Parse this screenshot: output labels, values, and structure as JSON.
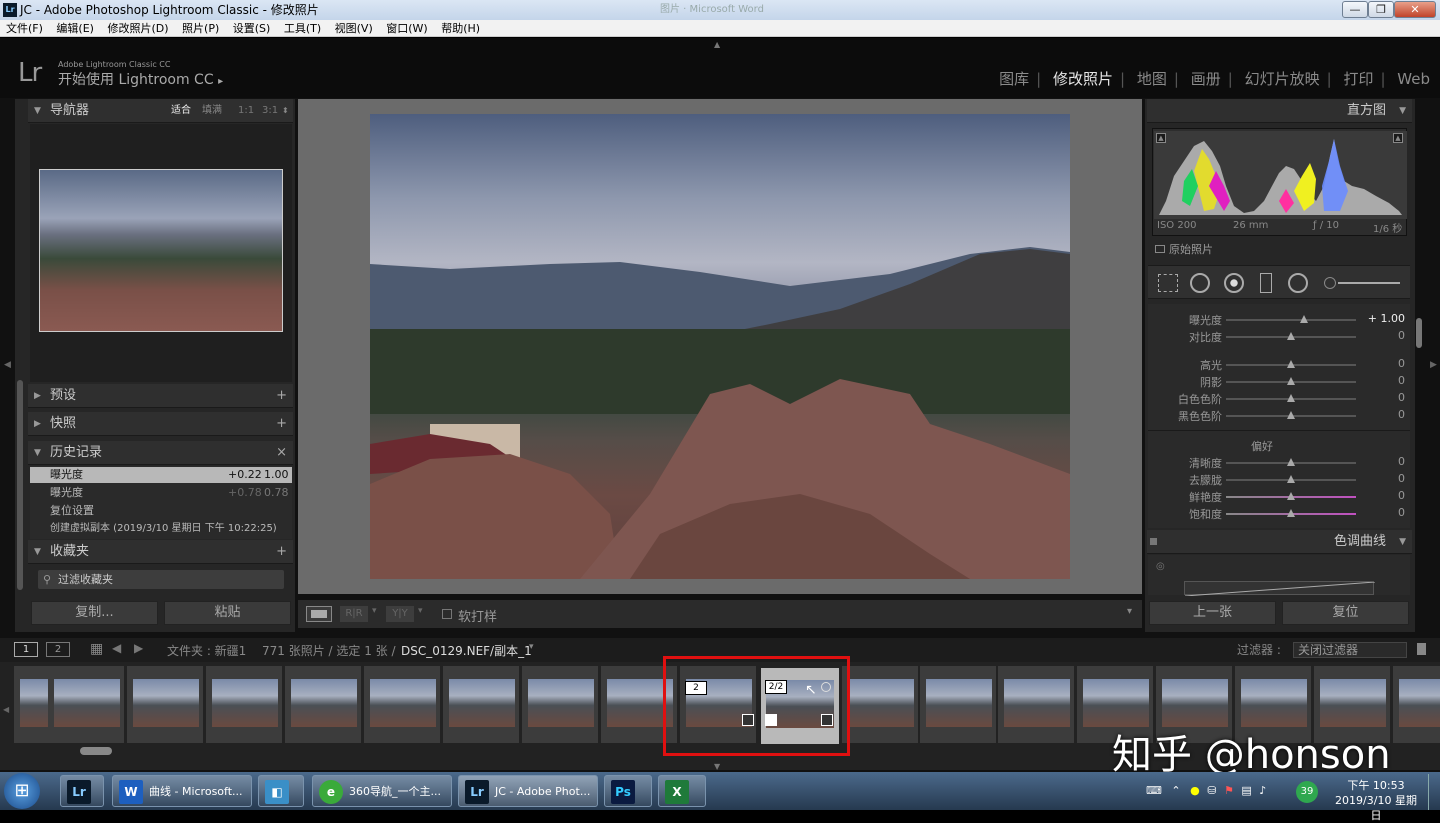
{
  "window": {
    "title": "JC - Adobe Photoshop Lightroom Classic - 修改照片",
    "ghost_tabs": "图片 · Microsoft Word",
    "controls": [
      "—",
      "❐",
      "✕"
    ]
  },
  "menubar": [
    "文件(F)",
    "编辑(E)",
    "修改照片(D)",
    "照片(P)",
    "设置(S)",
    "工具(T)",
    "视图(V)",
    "窗口(W)",
    "帮助(H)"
  ],
  "identity": {
    "logo": "Lr",
    "product": "Adobe Lightroom Classic CC",
    "start": "开始使用 Lightroom CC",
    "arrow": "▸"
  },
  "modules": [
    {
      "label": "图库",
      "active": false
    },
    {
      "label": "修改照片",
      "active": true
    },
    {
      "label": "地图",
      "active": false
    },
    {
      "label": "画册",
      "active": false
    },
    {
      "label": "幻灯片放映",
      "active": false
    },
    {
      "label": "打印",
      "active": false
    },
    {
      "label": "Web",
      "active": false
    }
  ],
  "navigator": {
    "title": "导航器",
    "zoom": [
      "适合",
      "填满",
      "1:1",
      "3:1"
    ],
    "zoom_active": "适合"
  },
  "presets": {
    "title": "预设",
    "add": "+"
  },
  "snapshots": {
    "title": "快照",
    "add": "+"
  },
  "history": {
    "title": "历史记录",
    "close": "×",
    "items": [
      {
        "label": "曝光度",
        "delta": "+0.22",
        "value": "1.00",
        "selected": true
      },
      {
        "label": "曝光度",
        "delta": "+0.78",
        "value": "0.78",
        "selected": false
      },
      {
        "label": "复位设置",
        "delta": "",
        "value": "",
        "selected": false
      },
      {
        "label": "创建虚拟副本 (2019/3/10 星期日 下午 10:22:25)",
        "delta": "",
        "value": "",
        "selected": false
      }
    ]
  },
  "collections": {
    "title": "收藏夹",
    "add": "+",
    "filter": "过滤收藏夹"
  },
  "left_buttons": {
    "copy": "复制...",
    "paste": "粘贴"
  },
  "toolbar": {
    "softproof": "软打样",
    "yy": "Y|Y",
    "rr": "R|R",
    "dropdown": "▾"
  },
  "histogram": {
    "title": "直方图",
    "iso": "ISO 200",
    "focal": "26 mm",
    "aperture": "ƒ / 10",
    "shutter": "1/6 秒",
    "original": "原始照片"
  },
  "basic": {
    "sliders": [
      {
        "label": "曝光度",
        "value": "+ 1.00",
        "pos": 0.6
      },
      {
        "label": "对比度",
        "value": "0",
        "pos": 0.5
      },
      {
        "label": "高光",
        "value": "0",
        "pos": 0.5
      },
      {
        "label": "阴影",
        "value": "0",
        "pos": 0.5
      },
      {
        "label": "白色色阶",
        "value": "0",
        "pos": 0.5
      },
      {
        "label": "黑色色阶",
        "value": "0",
        "pos": 0.5
      }
    ],
    "presence_title": "偏好",
    "presence": [
      {
        "label": "清晰度",
        "value": "0",
        "pos": 0.5
      },
      {
        "label": "去朦胧",
        "value": "0",
        "pos": 0.5
      },
      {
        "label": "鲜艳度",
        "value": "0",
        "pos": 0.5
      },
      {
        "label": "饱和度",
        "value": "0",
        "pos": 0.5
      }
    ]
  },
  "tone_curve": {
    "title": "色调曲线"
  },
  "right_buttons": {
    "prev": "上一张",
    "reset": "复位"
  },
  "filmstrip_bar": {
    "view1": "1",
    "view2": "2",
    "path_prefix": "文件夹 : 新疆1",
    "count": "771 张照片 / 选定 1 张 /",
    "file": "DSC_0129.NEF/副本_1",
    "filter_label": "过滤器 :",
    "filter_value": "关闭过滤器"
  },
  "filmstrip": {
    "stack_badges": [
      "2",
      "2/2"
    ],
    "thumb_count": 18,
    "highlight_color": "#e01010"
  },
  "watermark": "知乎 @honson",
  "taskbar": {
    "start": "⊞",
    "items": [
      {
        "label": "",
        "icon": "Lr",
        "color": "#0a1a2a"
      },
      {
        "label": "曲线 - Microsoft...",
        "icon": "W",
        "color": "#1d5fbf"
      },
      {
        "label": "",
        "icon": "◧",
        "color": "#3a8fc7"
      },
      {
        "label": "360导航_一个主...",
        "icon": "e",
        "color": "#3aaa3a"
      },
      {
        "label": "JC - Adobe Phot...",
        "icon": "Lr",
        "color": "#0a1a2a"
      },
      {
        "label": "",
        "icon": "Ps",
        "color": "#0a1a40"
      },
      {
        "label": "",
        "icon": "X",
        "color": "#1f7a3a"
      }
    ],
    "badge": "39",
    "time": "下午 10:53",
    "date": "2019/3/10 星期日"
  }
}
